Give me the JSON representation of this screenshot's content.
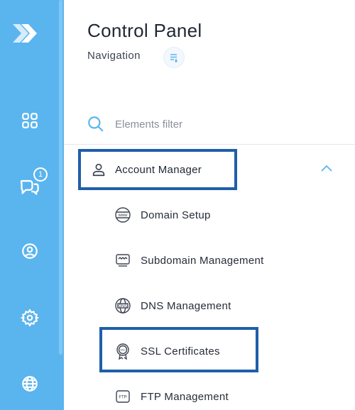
{
  "header": {
    "title": "Control Panel",
    "subtitle": "Navigation"
  },
  "rail": {
    "badge_count": "1"
  },
  "filter": {
    "placeholder": "Elements filter"
  },
  "menu": {
    "group_label": "Account Manager",
    "items": [
      {
        "label": "Domain Setup",
        "icon": "www-globe-icon"
      },
      {
        "label": "Subdomain Management",
        "icon": "subdomain-window-icon"
      },
      {
        "label": "DNS Management",
        "icon": "dns-globe-icon"
      },
      {
        "label": "SSL Certificates",
        "icon": "ssl-certificate-icon"
      },
      {
        "label": "FTP Management",
        "icon": "ftp-icon"
      }
    ]
  },
  "colors": {
    "rail": "#5ab4ee",
    "highlight_border": "#1f5fa8",
    "accent": "#5ab4ee"
  }
}
